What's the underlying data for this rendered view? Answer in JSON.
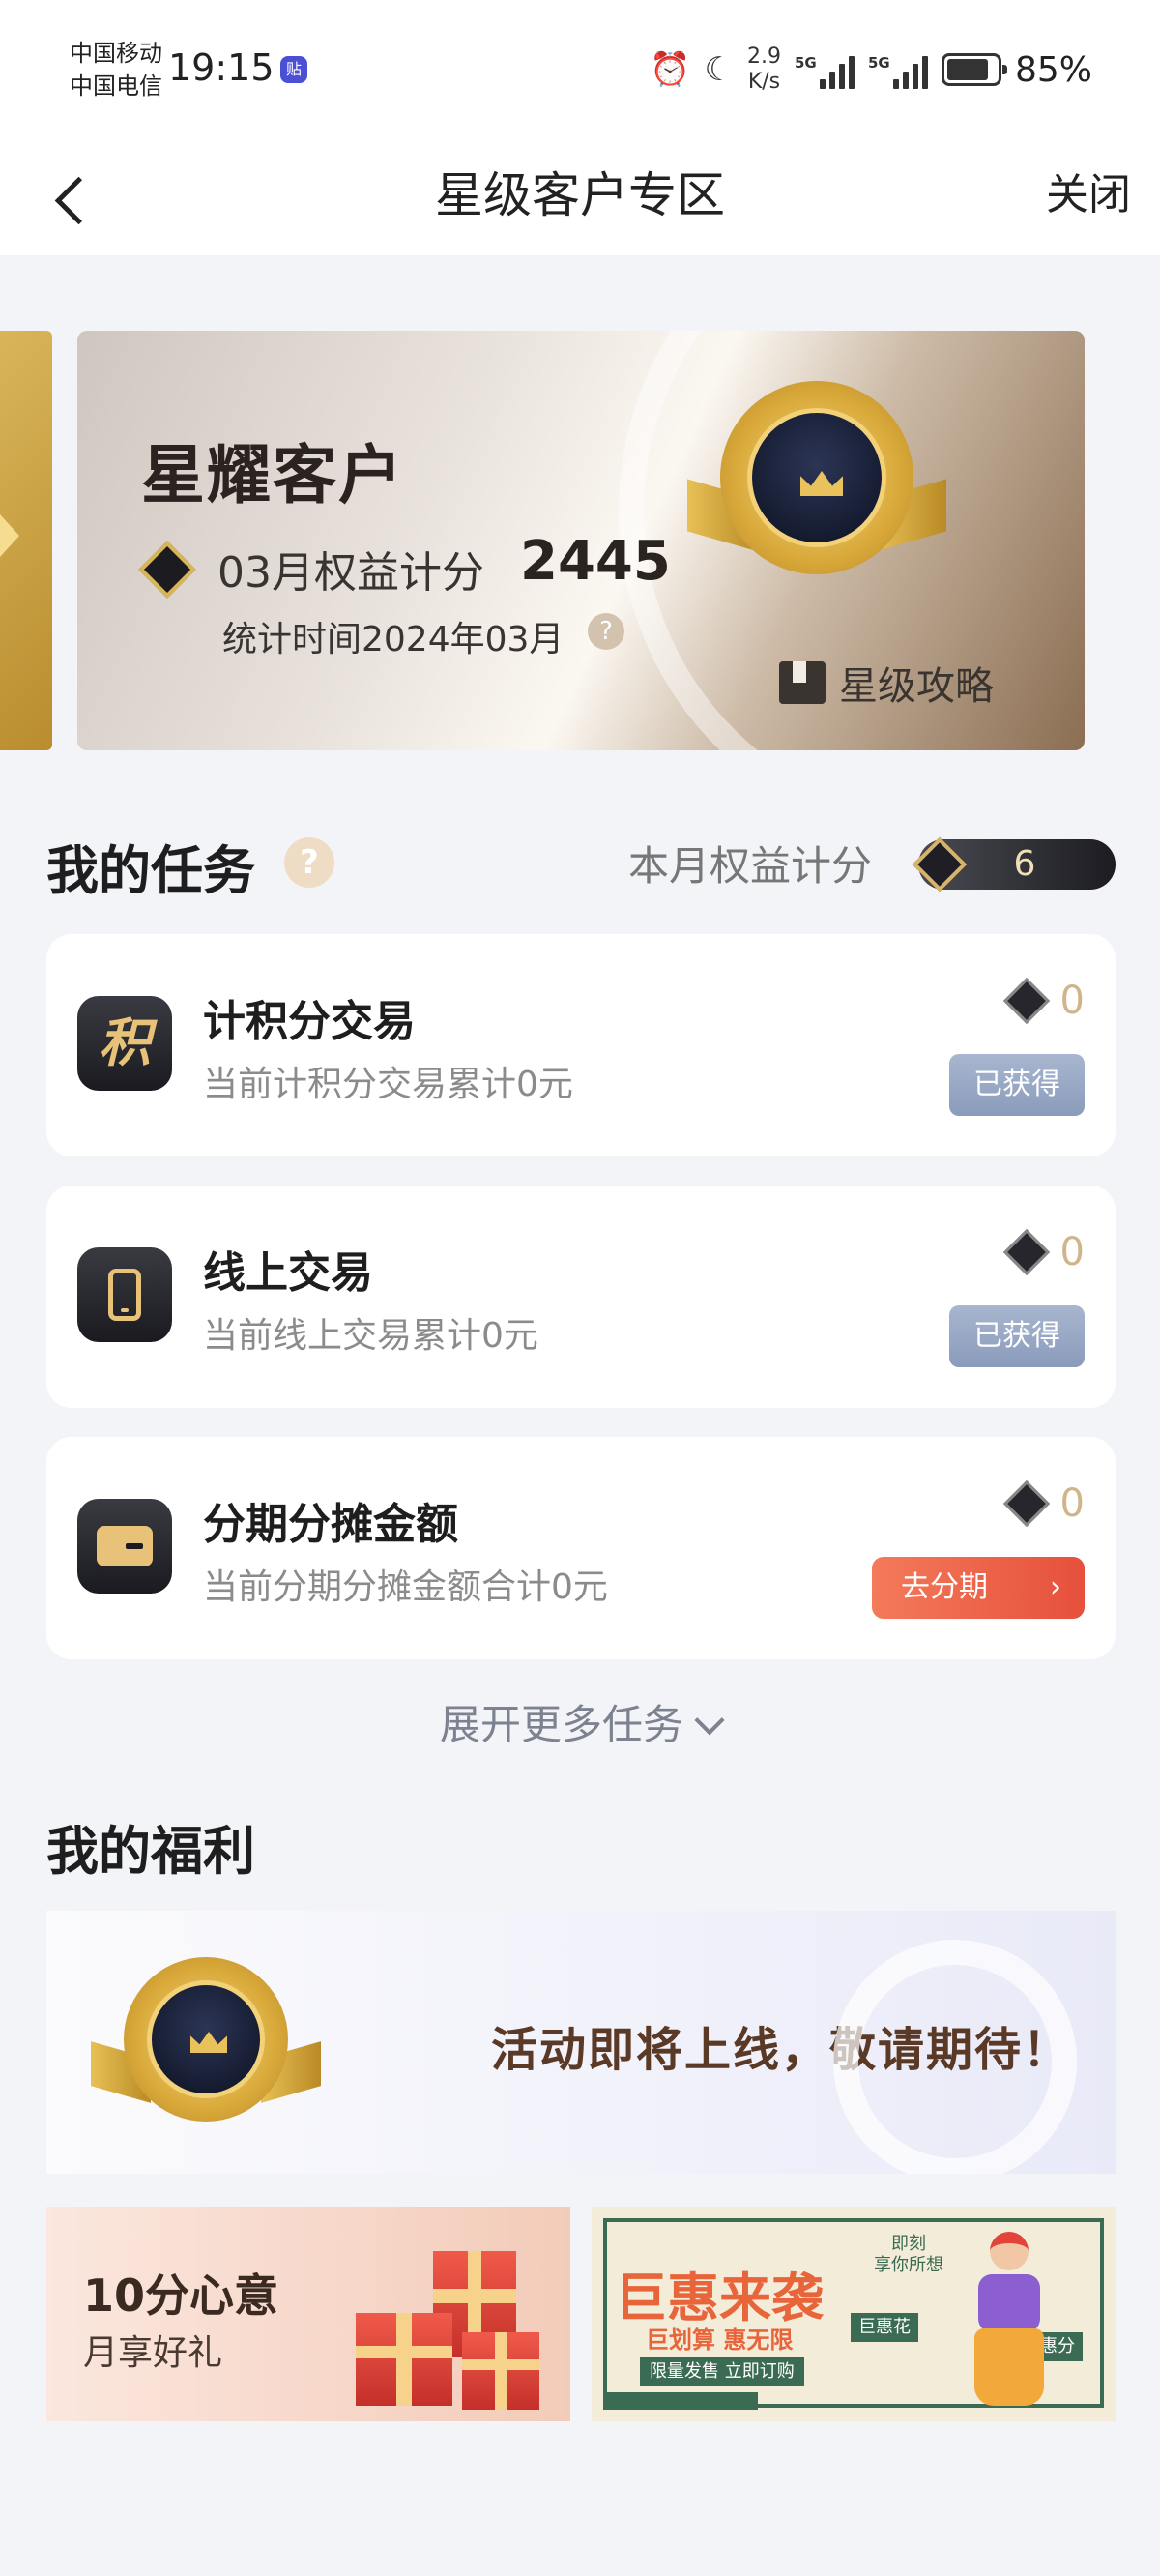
{
  "status_bar": {
    "carrier1": "中国移动",
    "carrier2": "中国电信",
    "time": "19:15",
    "app_badge": "贴",
    "net_speed_value": "2.9",
    "net_speed_unit": "K/s",
    "signal1": "5G",
    "signal2": "5G",
    "battery_level": 0.85,
    "battery_pct": "85%",
    "icons": [
      "alarm-icon",
      "moon-icon"
    ]
  },
  "nav": {
    "title": "星级客户专区",
    "close_label": "关闭"
  },
  "hero": {
    "title": "星耀客户",
    "score_label": "03月权益计分",
    "score": "2445",
    "stat_time": "统计时间2024年03月",
    "help": "?",
    "guide_label": "星级攻略"
  },
  "tasks_section": {
    "title": "我的任务",
    "help": "?",
    "month_label": "本月权益计分",
    "month_value": "6",
    "items": [
      {
        "icon": "积",
        "name": "计积分交易",
        "desc": "当前计积分交易累计0元",
        "points": "0",
        "action": "已获得"
      },
      {
        "icon": "phone-icon",
        "name": "线上交易",
        "desc": "当前线上交易累计0元",
        "points": "0",
        "action": "已获得"
      },
      {
        "icon": "card-icon",
        "name": "分期分摊金额",
        "desc": "当前分期分摊金额合计0元",
        "points": "0",
        "action": "去分期",
        "action_arrow": "›"
      }
    ],
    "expand_label": "展开更多任务"
  },
  "welfare_section": {
    "title": "我的福利",
    "coming_soon": "活动即将上线，敬请期待！",
    "gift_card": {
      "title": "10分心意",
      "subtitle": "月享好礼"
    },
    "promo_card": {
      "title": "巨惠来袭",
      "subtitle": "巨划算 惠无限",
      "top_text1": "即刻",
      "top_text2": "享你所想",
      "button_text": "限量发售 立即订购",
      "tag1": "巨惠花",
      "tag2": "巨惠分"
    }
  },
  "colors": {
    "page_bg": "#f3f4f7",
    "gold": "#d9b55a",
    "got_button": "#8a9bbb",
    "go_button": "#e6503c"
  }
}
